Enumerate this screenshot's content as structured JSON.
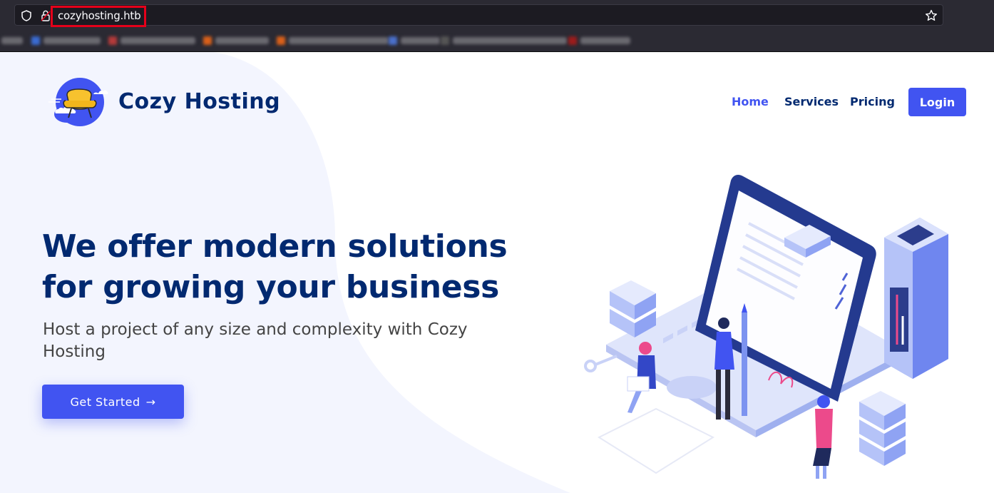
{
  "browser": {
    "url": "cozyhosting.htb"
  },
  "site": {
    "brand": "Cozy Hosting",
    "nav": [
      {
        "label": "Home",
        "active": true
      },
      {
        "label": "Services",
        "active": false
      },
      {
        "label": "Pricing",
        "active": false
      }
    ],
    "login_label": "Login"
  },
  "hero": {
    "title_line1": "We offer modern solutions",
    "title_line2": "for growing your business",
    "subtitle": "Host a project of any size and complexity with Cozy Hosting",
    "cta_label": "Get Started",
    "cta_arrow": "→"
  },
  "colors": {
    "accent": "#4154f1",
    "heading": "#012970",
    "chrome_bg": "#2b2a33",
    "url_highlight": "#e5001a"
  }
}
